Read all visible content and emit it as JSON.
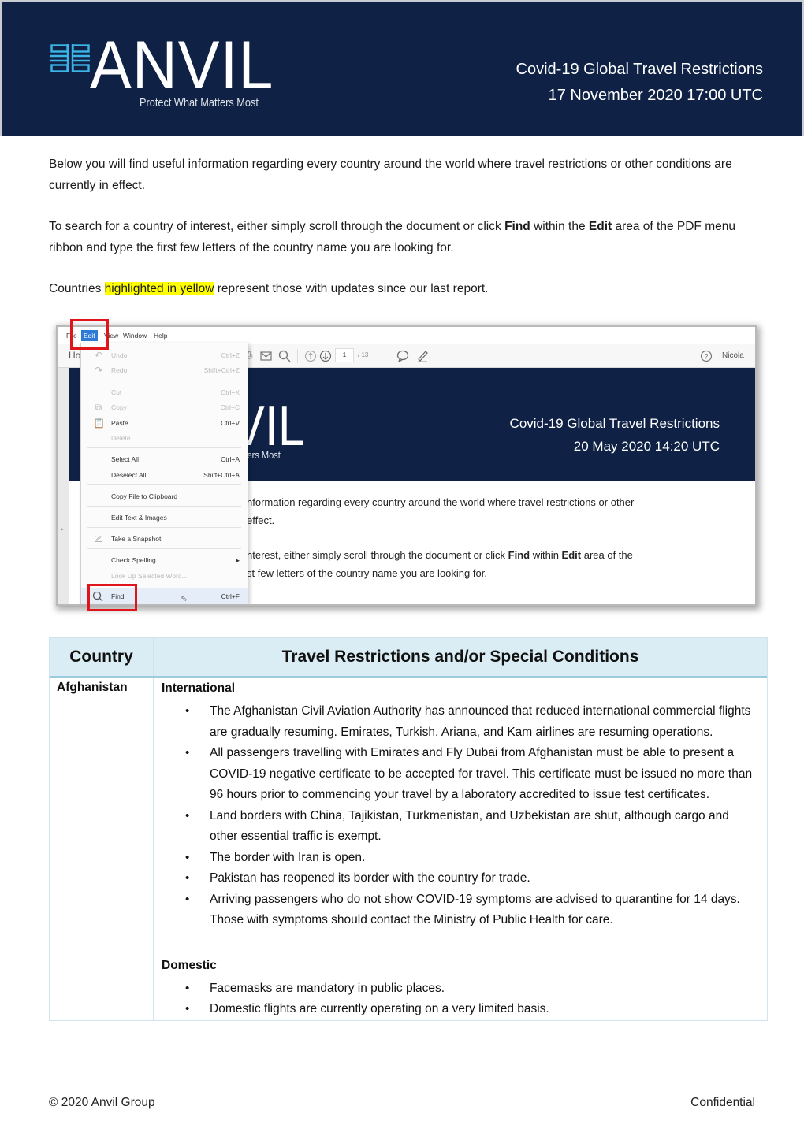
{
  "header": {
    "logo_word": "ANVIL",
    "logo_tagline": "Protect What Matters Most",
    "title": "Covid-19 Global Travel Restrictions",
    "date": "17 November 2020 17:00 UTC",
    "colors": {
      "banner": "#0f2246",
      "logo_mark": "#3cb4e6"
    }
  },
  "intro": {
    "p1": "Below you will find useful information regarding every country around the world where travel restrictions or other conditions are currently in effect.",
    "p2_a": "To search for a country of interest, either simply scroll through the document or click ",
    "p2_find": "Find",
    "p2_b": " within the ",
    "p2_edit": "Edit",
    "p2_c": " area of the PDF menu ribbon and type the first few letters of the country name you are looking for.",
    "p3_a": "Countries ",
    "p3_highlight": "highlighted in yellow",
    "p3_b": " represent those with updates since our last report.",
    "highlight_color": "#ffff00"
  },
  "screenshot": {
    "menubar": [
      "File",
      "Edit",
      "View",
      "Window",
      "Help"
    ],
    "toolbar_home": "Ho",
    "page_current": "1",
    "page_total": "/ 13",
    "user": "Nicola",
    "doc_logo_fragment": "VIL",
    "doc_tag_fragment": "Matters Most",
    "doc_title": "Covid-19 Global Travel Restrictions",
    "doc_date": "20 May 2020 14:20 UTC",
    "doc_line1": "nformation regarding every country around the world where travel restrictions or other",
    "doc_line2": "effect.",
    "doc_line3_a": "nterest, either simply scroll through the document or click ",
    "doc_line3_find": "Find",
    "doc_line3_b": " within ",
    "doc_line3_edit": "Edit",
    "doc_line3_c": " area of the",
    "doc_line4": "st few letters of the country name you are looking for.",
    "edit_menu": [
      {
        "label": "Undo",
        "shortcut": "Ctrl+Z",
        "icon": "undo-icon",
        "disabled": true
      },
      {
        "label": "Redo",
        "shortcut": "Shift+Ctrl+Z",
        "icon": "redo-icon",
        "disabled": true
      },
      {
        "label": "Cut",
        "shortcut": "Ctrl+X",
        "icon": "",
        "disabled": true
      },
      {
        "label": "Copy",
        "shortcut": "Ctrl+C",
        "icon": "copy-icon",
        "disabled": true
      },
      {
        "label": "Paste",
        "shortcut": "Ctrl+V",
        "icon": "paste-icon",
        "disabled": false
      },
      {
        "label": "Delete",
        "shortcut": "",
        "icon": "",
        "disabled": true
      },
      {
        "label": "Select All",
        "shortcut": "Ctrl+A",
        "icon": "",
        "disabled": false
      },
      {
        "label": "Deselect All",
        "shortcut": "Shift+Ctrl+A",
        "icon": "",
        "disabled": false
      },
      {
        "label": "Copy File to Clipboard",
        "shortcut": "",
        "icon": "",
        "disabled": false
      },
      {
        "label": "Edit Text & Images",
        "shortcut": "",
        "icon": "",
        "disabled": false
      },
      {
        "label": "Take a Snapshot",
        "shortcut": "",
        "icon": "camera-icon",
        "disabled": false
      },
      {
        "label": "Check Spelling",
        "shortcut": "▸",
        "icon": "",
        "disabled": false
      },
      {
        "label": "Look Up Selected Word...",
        "shortcut": "",
        "icon": "",
        "disabled": true
      },
      {
        "label": "Find",
        "shortcut": "Ctrl+F",
        "icon": "search-icon",
        "disabled": false,
        "selected": true
      }
    ],
    "highlight_color": "#e0141b"
  },
  "table": {
    "headers": [
      "Country",
      "Travel Restrictions and/or Special Conditions"
    ],
    "rows": [
      {
        "country": "Afghanistan",
        "sections": [
          {
            "title": "International",
            "items": [
              "The Afghanistan Civil Aviation Authority has announced that reduced international commercial flights are gradually resuming. Emirates, Turkish, Ariana, and Kam airlines are resuming operations.",
              "All passengers travelling with Emirates and Fly Dubai from Afghanistan must be able to present a COVID-19 negative certificate to be accepted for travel. This certificate must be issued no more than 96 hours prior to commencing your travel by a laboratory accredited to issue test certificates.",
              "Land borders with China, Tajikistan, Turkmenistan, and Uzbekistan are shut, although cargo and other essential traffic is exempt.",
              "The border with Iran is open.",
              "Pakistan has reopened its border with the country for trade.",
              "Arriving passengers who do not show COVID-19 symptoms are advised to quarantine for 14 days. Those with symptoms should contact the Ministry of Public Health for care."
            ]
          },
          {
            "title": "Domestic",
            "items": [
              "Facemasks are mandatory in public places.",
              "Domestic flights are currently operating on a very limited basis."
            ]
          }
        ]
      }
    ]
  },
  "footer": {
    "copyright": "© 2020 Anvil Group",
    "classification": "Confidential"
  }
}
